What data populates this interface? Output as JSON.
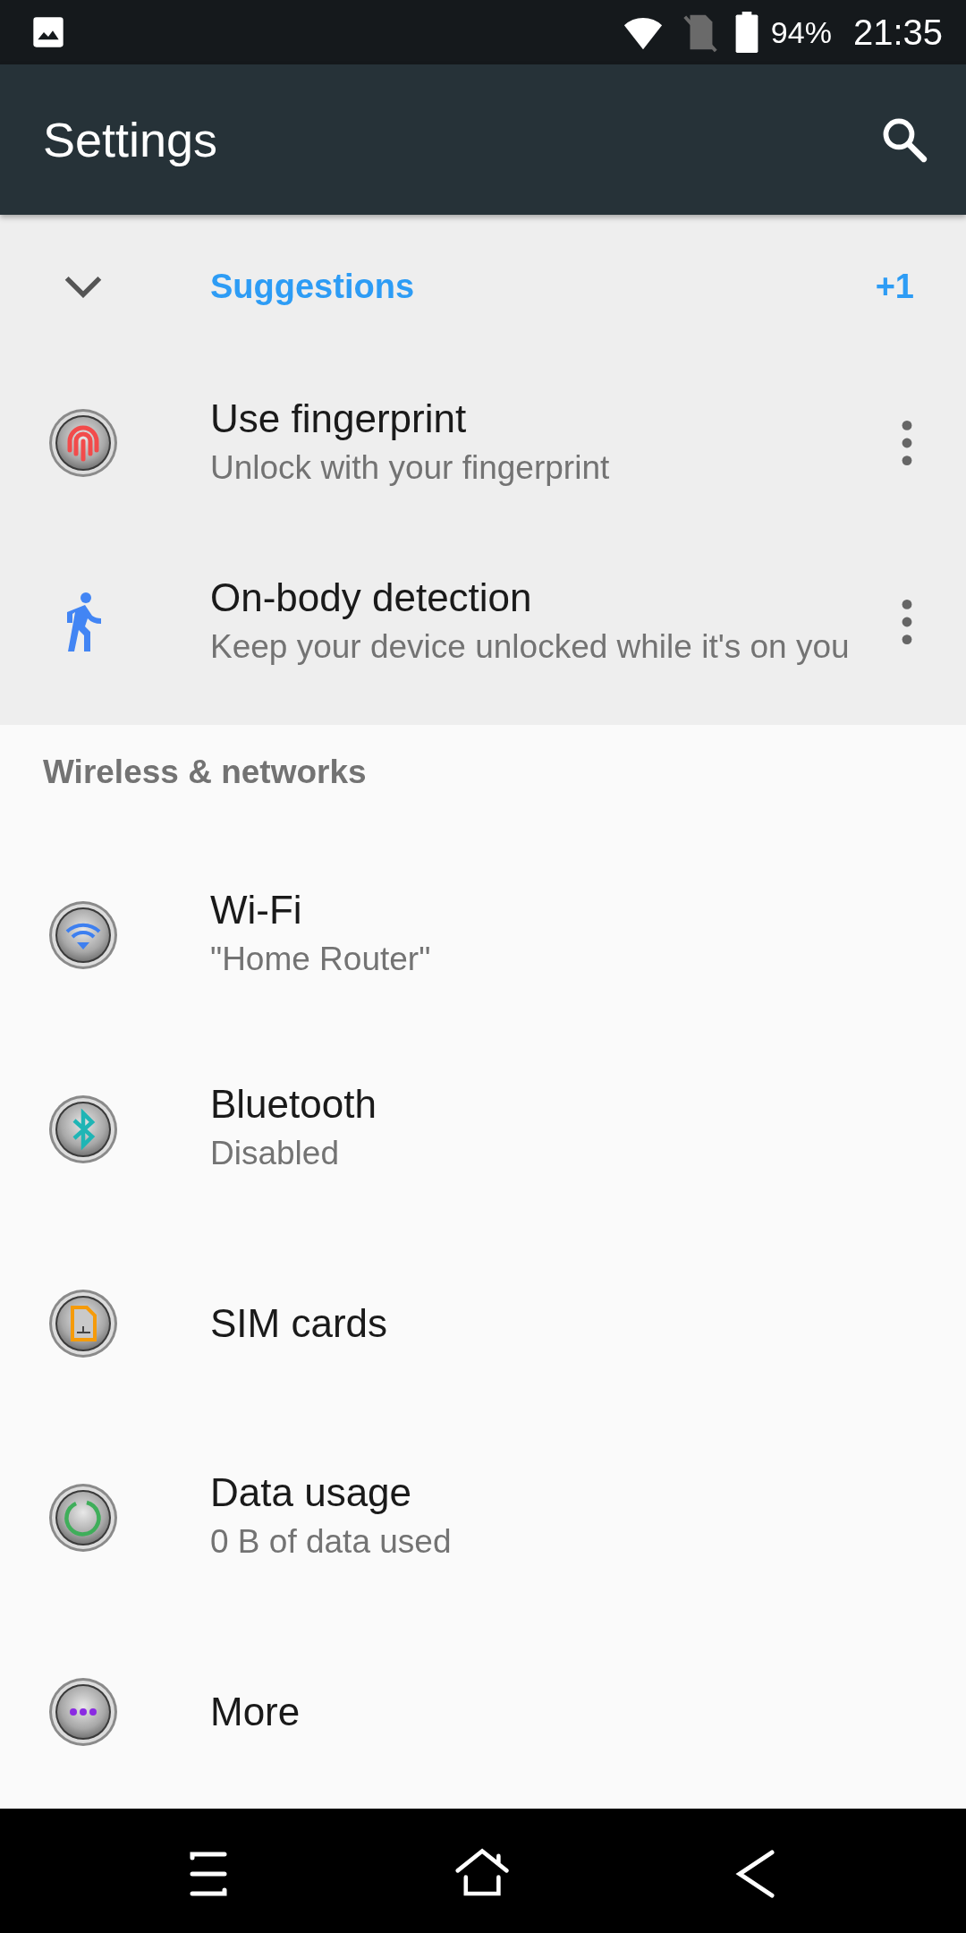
{
  "status_bar": {
    "battery": "94%",
    "time": "21:35"
  },
  "app_bar": {
    "title": "Settings"
  },
  "suggestions": {
    "title": "Suggestions",
    "count": "+1",
    "expanded": true,
    "items": [
      {
        "kind": "fingerprint",
        "title": "Use fingerprint",
        "summary": "Unlock with your fingerprint"
      },
      {
        "kind": "walk",
        "title": "On-body detection",
        "summary": "Keep your device unlocked while it's on you"
      }
    ]
  },
  "section": {
    "title": "Wireless & networks",
    "items": [
      {
        "kind": "wifi",
        "title": "Wi-Fi",
        "summary": "\"Home Router\""
      },
      {
        "kind": "bluetooth",
        "title": "Bluetooth",
        "summary": "Disabled"
      },
      {
        "kind": "sim",
        "title": "SIM cards"
      },
      {
        "kind": "data",
        "title": "Data usage",
        "summary": "0 B of data used"
      },
      {
        "kind": "more",
        "title": "More"
      }
    ]
  }
}
